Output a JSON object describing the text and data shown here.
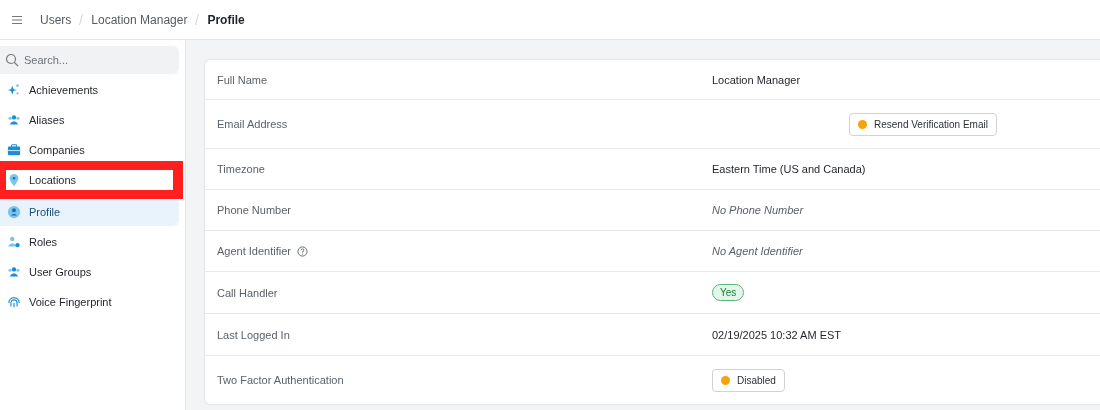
{
  "breadcrumbs": [
    {
      "label": "Users",
      "current": false
    },
    {
      "label": "Location Manager",
      "current": false
    },
    {
      "label": "Profile",
      "current": true
    }
  ],
  "sidebar": {
    "search": {
      "placeholder": "Search..."
    },
    "items": [
      {
        "label": "Achievements",
        "selected": false,
        "highlighted": false
      },
      {
        "label": "Aliases",
        "selected": false,
        "highlighted": false
      },
      {
        "label": "Companies",
        "selected": false,
        "highlighted": false
      },
      {
        "label": "Locations",
        "selected": false,
        "highlighted": true
      },
      {
        "label": "Profile",
        "selected": true,
        "highlighted": false
      },
      {
        "label": "Roles",
        "selected": false,
        "highlighted": false
      },
      {
        "label": "User Groups",
        "selected": false,
        "highlighted": false
      },
      {
        "label": "Voice Fingerprint",
        "selected": false,
        "highlighted": false
      }
    ]
  },
  "fields": [
    {
      "label": "Full Name",
      "kind": "text",
      "value": "Location Manager"
    },
    {
      "label": "Email Address",
      "kind": "status-button",
      "value": "Resend Verification Email",
      "color": "#f5a30a"
    },
    {
      "label": "Timezone",
      "kind": "text",
      "value": "Eastern Time (US and Canada)"
    },
    {
      "label": "Phone Number",
      "kind": "empty",
      "value": "No Phone Number"
    },
    {
      "label": "Agent Identifier",
      "kind": "empty",
      "value": "No Agent Identifier",
      "help": true
    },
    {
      "label": "Call Handler",
      "kind": "pill",
      "value": "Yes"
    },
    {
      "label": "Last Logged In",
      "kind": "text",
      "value": "02/19/2025 10:32 AM EST"
    },
    {
      "label": "Two Factor Authentication",
      "kind": "status-button",
      "value": "Disabled",
      "color": "#f5a30a"
    }
  ]
}
